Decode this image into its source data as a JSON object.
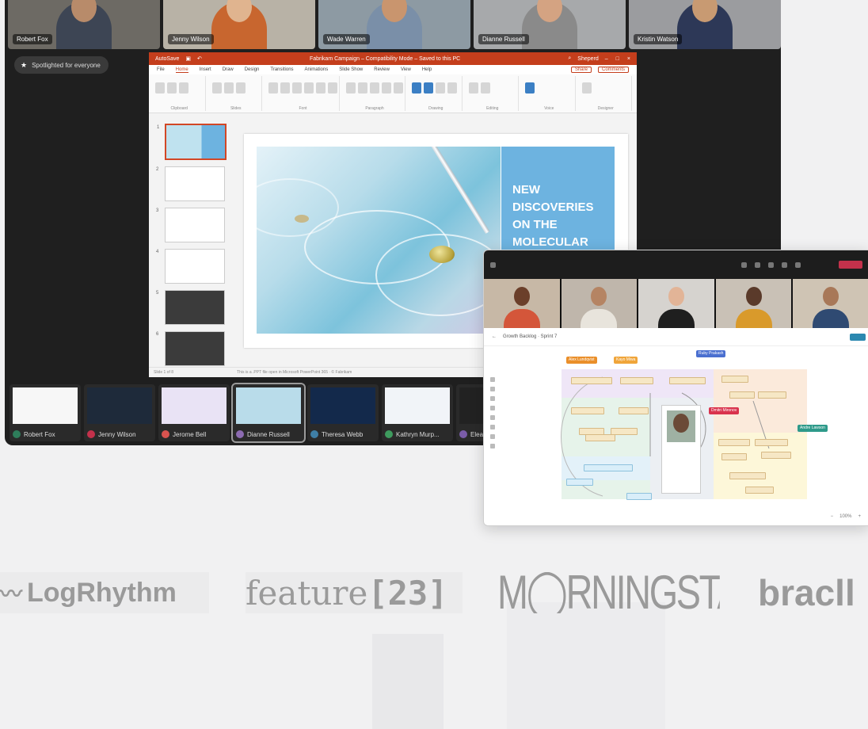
{
  "meeting": {
    "participants_top": [
      {
        "name": "Robert Fox",
        "bg": "#6d6a64",
        "shirt": "#3d4554",
        "skin": "#b88b6a"
      },
      {
        "name": "Jenny Wilson",
        "bg": "#b8b2a6",
        "shirt": "#c8662f",
        "skin": "#e0b48f"
      },
      {
        "name": "Wade Warren",
        "bg": "#8d9aa3",
        "shirt": "#7a8fa8",
        "skin": "#c9956e"
      },
      {
        "name": "Dianne Russell",
        "bg": "#a7a9ab",
        "shirt": "#8a8a8a",
        "skin": "#d4a382"
      },
      {
        "name": "Kristin Watson",
        "bg": "#9b9c9f",
        "shirt": "#2d3857",
        "skin": "#c89a72"
      }
    ],
    "spotlight_label": "Spotlighted for everyone"
  },
  "ppt": {
    "title": "Fabrikam Campaign – Compatibility Mode – Saved to this PC",
    "autosave": "AutoSave",
    "user": "Sheperd",
    "menu": [
      "File",
      "Home",
      "Insert",
      "Draw",
      "Design",
      "Transitions",
      "Animations",
      "Slide Show",
      "Review",
      "View",
      "Help"
    ],
    "share": "Share",
    "comments": "Comments",
    "ribbon_groups": [
      "Clipboard",
      "Slides",
      "Font",
      "Paragraph",
      "Drawing",
      "Editing",
      "Voice",
      "Designer"
    ],
    "slide_numbers": [
      "1",
      "2",
      "3",
      "4",
      "5",
      "6"
    ],
    "headline": "NEW DISCOVERIES ON THE MOLECULAR",
    "status_left": "Slide 1 of 8",
    "status_mid": "This is a .PPT file open in Microsoft PowerPoint 365 · © Fabrikam"
  },
  "shared_screens": [
    {
      "name": "Robert Fox",
      "color": "#2e7d5b"
    },
    {
      "name": "Jenny Wilson",
      "color": "#c4314b"
    },
    {
      "name": "Jerome Bell",
      "color": "#d9534f"
    },
    {
      "name": "Dianne Russell",
      "color": "#8c6bb1"
    },
    {
      "name": "Theresa Webb",
      "color": "#3f7fa6"
    },
    {
      "name": "Kathryn Murp...",
      "color": "#3e9b5e"
    },
    {
      "name": "Eleanor",
      "color": "#7a5ca8"
    }
  ],
  "whiteboard": {
    "board_title": "Growth Backlog · Sprint 7",
    "share_chip": "Share",
    "tags": [
      "Alex Lundqvist",
      "Kayo Miwa",
      "Ruby Prakash",
      "Dmitri Mironov",
      "Andre Lawson"
    ],
    "zoom": "100%"
  },
  "logos": {
    "logrhythm": "LogRhythm",
    "feature_text": "feature",
    "feature_num": "[23]",
    "morningstar": "M◯RNINGSTAR",
    "brac": "bracll"
  }
}
